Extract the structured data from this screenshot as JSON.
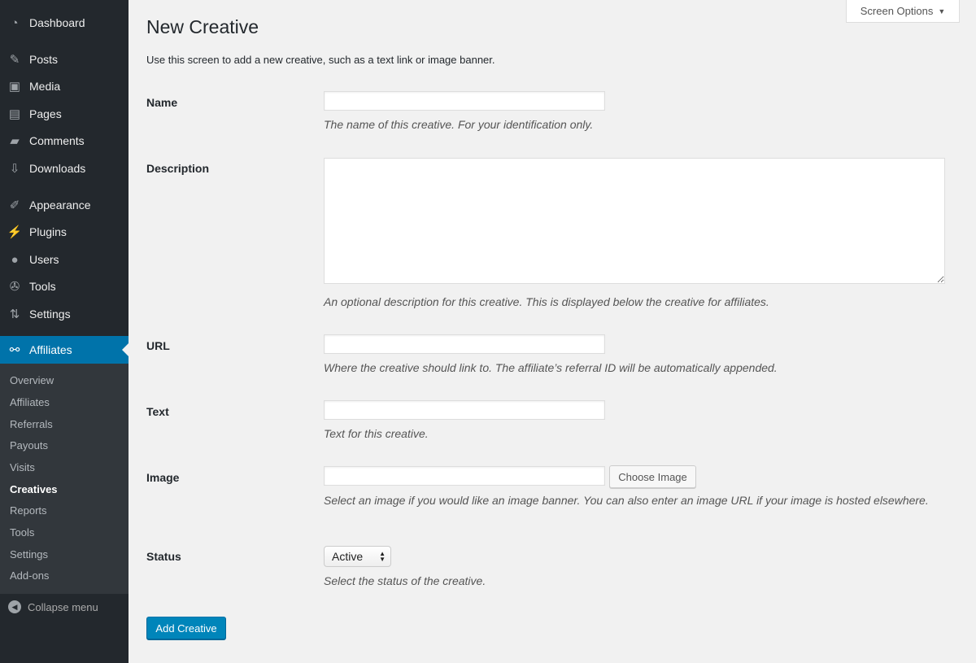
{
  "sidebar": {
    "items": [
      {
        "label": "Dashboard",
        "icon": "dashboard-icon"
      },
      {
        "label": "Posts",
        "icon": "pin-icon"
      },
      {
        "label": "Media",
        "icon": "media-icon"
      },
      {
        "label": "Pages",
        "icon": "pages-icon"
      },
      {
        "label": "Comments",
        "icon": "comment-icon"
      },
      {
        "label": "Downloads",
        "icon": "download-icon"
      },
      {
        "label": "Appearance",
        "icon": "brush-icon"
      },
      {
        "label": "Plugins",
        "icon": "plug-icon"
      },
      {
        "label": "Users",
        "icon": "user-icon"
      },
      {
        "label": "Tools",
        "icon": "wrench-icon"
      },
      {
        "label": "Settings",
        "icon": "settings-icon"
      },
      {
        "label": "Affiliates",
        "icon": "affiliates-icon"
      }
    ],
    "submenu": [
      "Overview",
      "Affiliates",
      "Referrals",
      "Payouts",
      "Visits",
      "Creatives",
      "Reports",
      "Tools",
      "Settings",
      "Add-ons"
    ],
    "current_submenu": "Creatives",
    "collapse": "Collapse menu"
  },
  "screen_options": "Screen Options",
  "page": {
    "title": "New Creative",
    "intro": "Use this screen to add a new creative, such as a text link or image banner.",
    "fields": {
      "name": {
        "label": "Name",
        "value": "",
        "description": "The name of this creative. For your identification only."
      },
      "description": {
        "label": "Description",
        "value": "",
        "description": "An optional description for this creative. This is displayed below the creative for affiliates."
      },
      "url": {
        "label": "URL",
        "value": "",
        "description": "Where the creative should link to. The affiliate’s referral ID will be automatically appended."
      },
      "text": {
        "label": "Text",
        "value": "",
        "description": "Text for this creative."
      },
      "image": {
        "label": "Image",
        "value": "",
        "button": "Choose Image",
        "description": "Select an image if you would like an image banner. You can also enter an image URL if your image is hosted elsewhere."
      },
      "status": {
        "label": "Status",
        "value": "Active",
        "description": "Select the status of the creative."
      }
    },
    "submit": "Add Creative"
  },
  "colors": {
    "sidebar": "#23282d",
    "submenu": "#32373c",
    "accent": "#0073aa",
    "button": "#0085ba"
  }
}
